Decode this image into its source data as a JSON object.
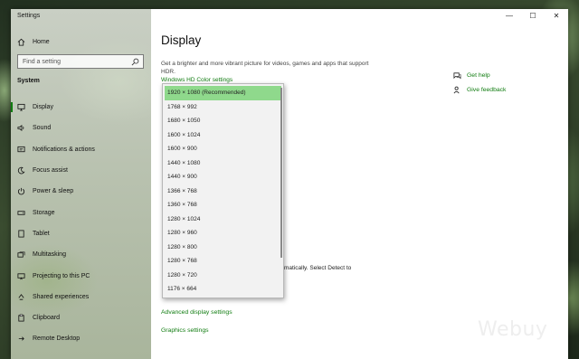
{
  "window": {
    "title": "Settings",
    "controls": {
      "minimize": "—",
      "maximize": "☐",
      "close": "✕"
    }
  },
  "sidebar": {
    "home_label": "Home",
    "search_placeholder": "Find a setting",
    "section_label": "System",
    "items": [
      {
        "label": "Display",
        "icon": "monitor-icon",
        "active": true
      },
      {
        "label": "Sound",
        "icon": "speaker-icon"
      },
      {
        "label": "Notifications & actions",
        "icon": "notification-icon"
      },
      {
        "label": "Focus assist",
        "icon": "moon-icon"
      },
      {
        "label": "Power & sleep",
        "icon": "power-icon"
      },
      {
        "label": "Storage",
        "icon": "storage-icon"
      },
      {
        "label": "Tablet",
        "icon": "tablet-icon"
      },
      {
        "label": "Multitasking",
        "icon": "multitasking-icon"
      },
      {
        "label": "Projecting to this PC",
        "icon": "projector-icon"
      },
      {
        "label": "Shared experiences",
        "icon": "shared-icon"
      },
      {
        "label": "Clipboard",
        "icon": "clipboard-icon"
      },
      {
        "label": "Remote Desktop",
        "icon": "remote-desktop-icon"
      }
    ]
  },
  "main": {
    "title": "Display",
    "description": "Get a brighter and more vibrant picture for videos, games and apps that support HDR.",
    "hdr_link": "Windows HD Color settings",
    "partial_text": "matically. Select Detect to",
    "advanced_link": "Advanced display settings",
    "graphics_link": "Graphics settings",
    "help_link": "Get help",
    "feedback_link": "Give feedback"
  },
  "resolution_dropdown": {
    "selected": "1920 × 1080 (Recommended)",
    "options": [
      "1920 × 1080 (Recommended)",
      "1768 × 992",
      "1680 × 1050",
      "1600 × 1024",
      "1600 × 900",
      "1440 × 1080",
      "1440 × 900",
      "1366 × 768",
      "1360 × 768",
      "1280 × 1024",
      "1280 × 960",
      "1280 × 800",
      "1280 × 768",
      "1280 × 720",
      "1176 × 664"
    ]
  },
  "watermark": "Webuy",
  "colors": {
    "accent": "#107c10",
    "selected_bg": "#8fd98c"
  }
}
